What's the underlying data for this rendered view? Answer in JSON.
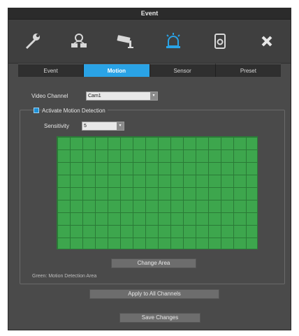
{
  "window": {
    "title": "Event"
  },
  "toolbar": {
    "items": [
      {
        "icon": "wrench-icon"
      },
      {
        "icon": "network-icon"
      },
      {
        "icon": "camera-icon"
      },
      {
        "icon": "alarm-icon"
      },
      {
        "icon": "storage-icon"
      },
      {
        "icon": "close-icon"
      }
    ]
  },
  "tabs": [
    {
      "label": "Event",
      "active": false
    },
    {
      "label": "Motion",
      "active": true
    },
    {
      "label": "Sensor",
      "active": false
    },
    {
      "label": "Preset",
      "active": false
    }
  ],
  "video_channel": {
    "label": "Video Channel",
    "value": "Cam1"
  },
  "motion": {
    "activate_label": "Activate Motion Detection",
    "activate_checked": true,
    "sensitivity_label": "Sensitivity",
    "sensitivity_value": "5",
    "grid": {
      "columns": 16,
      "rows": 9,
      "color": "#3da64d"
    },
    "change_area_label": "Change Area",
    "hint": "Green: Motion Detection Area"
  },
  "actions": {
    "apply_all_label": "Apply to All Channels",
    "save_label": "Save Changes"
  },
  "colors": {
    "accent": "#2aa3e6",
    "background": "#4a4a4a",
    "motion_area": "#3da64d"
  }
}
